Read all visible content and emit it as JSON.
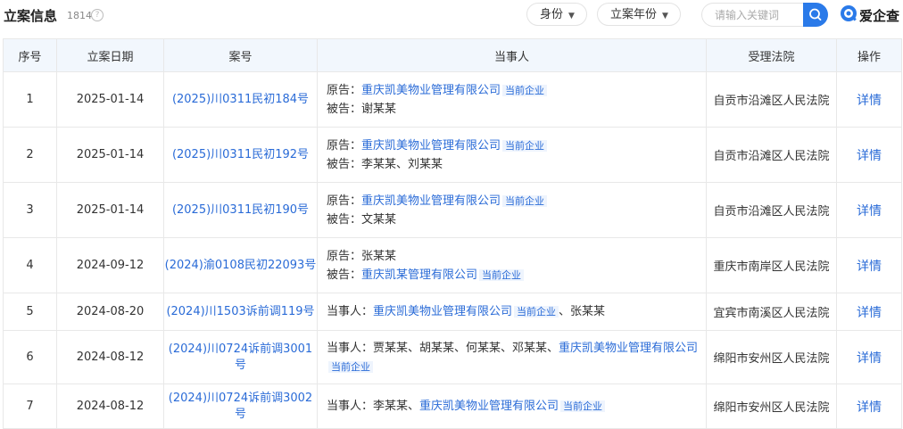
{
  "header": {
    "title": "立案信息",
    "count": "1814",
    "help_icon": "?",
    "filters": [
      "身份",
      "立案年份"
    ],
    "search_placeholder": "请输入关键词",
    "logo_text": "爱企查"
  },
  "table": {
    "columns": [
      "序号",
      "立案日期",
      "案号",
      "当事人",
      "受理法院",
      "操作"
    ],
    "rows": [
      {
        "no": "1",
        "date": "2025-01-14",
        "case": "(2025)川0311民初184号",
        "lines": [
          [
            {
              "t": "text",
              "v": "原告："
            },
            {
              "t": "link",
              "v": "重庆凯美物业管理有限公司"
            },
            {
              "t": "tag",
              "v": "当前企业"
            }
          ],
          [
            {
              "t": "text",
              "v": "被告：谢某某"
            }
          ]
        ],
        "court": "自贡市沿滩区人民法院",
        "op": "详情"
      },
      {
        "no": "2",
        "date": "2025-01-14",
        "case": "(2025)川0311民初192号",
        "lines": [
          [
            {
              "t": "text",
              "v": "原告："
            },
            {
              "t": "link",
              "v": "重庆凯美物业管理有限公司"
            },
            {
              "t": "tag",
              "v": "当前企业"
            }
          ],
          [
            {
              "t": "text",
              "v": "被告：李某某、刘某某"
            }
          ]
        ],
        "court": "自贡市沿滩区人民法院",
        "op": "详情"
      },
      {
        "no": "3",
        "date": "2025-01-14",
        "case": "(2025)川0311民初190号",
        "lines": [
          [
            {
              "t": "text",
              "v": "原告："
            },
            {
              "t": "link",
              "v": "重庆凯美物业管理有限公司"
            },
            {
              "t": "tag",
              "v": "当前企业"
            }
          ],
          [
            {
              "t": "text",
              "v": "被告：文某某"
            }
          ]
        ],
        "court": "自贡市沿滩区人民法院",
        "op": "详情"
      },
      {
        "no": "4",
        "date": "2024-09-12",
        "case": "(2024)渝0108民初22093号",
        "lines": [
          [
            {
              "t": "text",
              "v": "原告：张某某"
            }
          ],
          [
            {
              "t": "text",
              "v": "被告："
            },
            {
              "t": "link",
              "v": "重庆凯某管理有限公司"
            },
            {
              "t": "tag",
              "v": "当前企业"
            }
          ]
        ],
        "court": "重庆市南岸区人民法院",
        "op": "详情"
      },
      {
        "no": "5",
        "date": "2024-08-20",
        "case": "(2024)川1503诉前调119号",
        "lines": [
          [
            {
              "t": "text",
              "v": "当事人："
            },
            {
              "t": "link",
              "v": "重庆凯美物业管理有限公司"
            },
            {
              "t": "tag",
              "v": "当前企业"
            },
            {
              "t": "text",
              "v": "、张某某"
            }
          ]
        ],
        "court": "宜宾市南溪区人民法院",
        "op": "详情"
      },
      {
        "no": "6",
        "date": "2024-08-12",
        "case": "(2024)川0724诉前调3001号",
        "lines": [
          [
            {
              "t": "text",
              "v": "当事人：贾某某、胡某某、何某某、邓某某、"
            },
            {
              "t": "link",
              "v": "重庆凯美物业管理有限公司"
            }
          ],
          [
            {
              "t": "tag",
              "v": "当前企业"
            }
          ]
        ],
        "court": "绵阳市安州区人民法院",
        "op": "详情"
      },
      {
        "no": "7",
        "date": "2024-08-12",
        "case": "(2024)川0724诉前调3002号",
        "lines": [
          [
            {
              "t": "text",
              "v": "当事人：李某某、"
            },
            {
              "t": "link",
              "v": "重庆凯美物业管理有限公司"
            },
            {
              "t": "tag",
              "v": "当前企业"
            }
          ]
        ],
        "court": "绵阳市安州区人民法院",
        "op": "详情"
      }
    ]
  }
}
